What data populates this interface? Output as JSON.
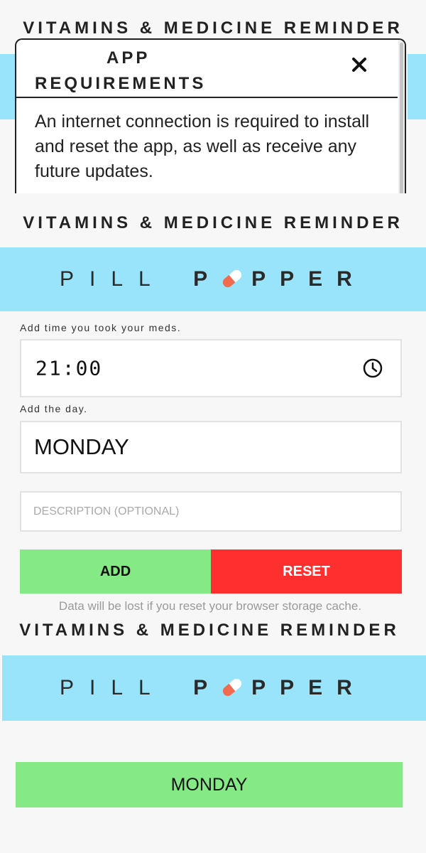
{
  "app": {
    "heading": "VITAMINS & MEDICINE REMINDER"
  },
  "modal": {
    "title_line1": "APP",
    "title_line2": "REQUIREMENTS",
    "body": "An internet connection is required to install and reset the app, as well as receive any future updates.",
    "close_icon": "close-icon"
  },
  "logo": {
    "word1": "PILL",
    "word2_first": "P",
    "word2_rest": "PPER",
    "capsule_colors": [
      "#f06b4f",
      "#ffffff"
    ]
  },
  "form": {
    "time_label": "Add time you took your meds.",
    "time_value": "21:00",
    "day_label": "Add the day.",
    "day_value": "MONDAY",
    "description_placeholder": "DESCRIPTION (OPTIONAL)",
    "description_value": ""
  },
  "buttons": {
    "add_label": "ADD",
    "reset_label": "RESET"
  },
  "warning": "Data will be lost if you reset your browser storage cache.",
  "schedule": {
    "days": [
      "MONDAY"
    ]
  },
  "colors": {
    "banner": "#99e4fa",
    "add": "#85e986",
    "reset": "#fd2f2f",
    "background": "#f7f7f7"
  }
}
